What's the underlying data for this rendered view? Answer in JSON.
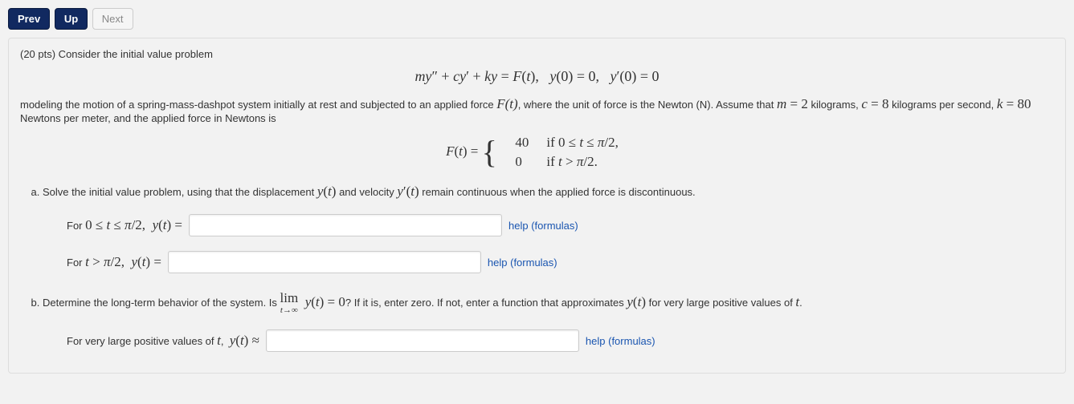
{
  "nav": {
    "prev": "Prev",
    "up": "Up",
    "next": "Next"
  },
  "problem": {
    "lead1": "(20 pts) Consider the initial value problem",
    "eq_main_html": "<span class='mathit'>my</span>&Prime; + <span class='mathit'>cy</span>&prime; + <span class='mathit'>ky</span> = <span class='mathit'>F</span>(<span class='mathit'>t</span>),&nbsp;&nbsp;&nbsp;<span class='mathit'>y</span>(0) = 0,&nbsp;&nbsp;&nbsp;<span class='mathit'>y</span>&prime;(0) = 0",
    "para2_pre": "modeling the motion of a spring-mass-dashpot system initially at rest and subjected to an applied force ",
    "Ft": "F(t)",
    "para2_post1": ", where the unit of force is the Newton (N). Assume that ",
    "m_eq": "m = 2",
    "m_unit": " kilograms, ",
    "c_eq": "c = 8",
    "c_unit": " kilograms per second, ",
    "k_eq": "k = 80",
    "k_unit": " Newtons per meter, and the applied force in Newtons is",
    "Ft_def_label": "F(t) = ",
    "piece1_val": "40",
    "piece1_cond": "if 0 ≤ t ≤ π/2,",
    "piece2_val": "0",
    "piece2_cond": "if t > π/2.",
    "partA": "Solve the initial value problem, using that the displacement ",
    "yt": "y(t)",
    "and_vel": " and velocity ",
    "ypt": "y′(t)",
    "partA_tail": " remain continuous when the applied force is discontinuous.",
    "rowA1_pre": "For ",
    "rowA1_cond": "0 ≤ t ≤ π/2,",
    "rowA1_eq": " y(t) = ",
    "rowA2_pre": "For ",
    "rowA2_cond": "t > π/2,",
    "rowA2_eq": " y(t) = ",
    "help_label": "help (formulas)",
    "partB_pre": "Determine the long-term behavior of the system. Is ",
    "lim_label": "lim",
    "lim_sub": "t→∞",
    "lim_expr": "y(t) = 0",
    "partB_post": "? If it is, enter zero. If not, enter a function that approximates ",
    "partB_tail": " for very large positive values of ",
    "t": "t",
    "rowB_pre": "For very large positive values of ",
    "rowB_eq": " y(t) ≈ "
  },
  "chart_data": null
}
